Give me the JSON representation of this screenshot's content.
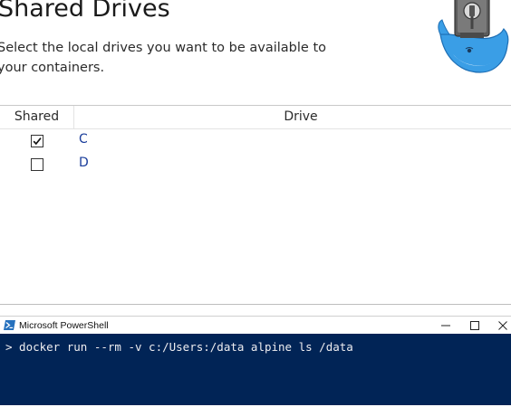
{
  "header": {
    "title": "Shared Drives",
    "description": "Select the local drives you want to be available to your containers."
  },
  "table": {
    "columns": [
      "Shared",
      "Drive"
    ],
    "rows": [
      {
        "checked": true,
        "drive": "C"
      },
      {
        "checked": false,
        "drive": "D"
      }
    ]
  },
  "powershell": {
    "window_title": "Microsoft PowerShell",
    "command_line": "> docker run --rm -v c:/Users:/data alpine ls /data",
    "background_color": "#012456"
  },
  "colors": {
    "drive_link": "#1a3d9b",
    "whale": "#3a9ee6"
  },
  "icons": [
    "docker-whale-logo",
    "checkbox-checked",
    "checkbox-unchecked",
    "powershell-icon",
    "minimize-icon",
    "maximize-icon",
    "close-icon"
  ]
}
